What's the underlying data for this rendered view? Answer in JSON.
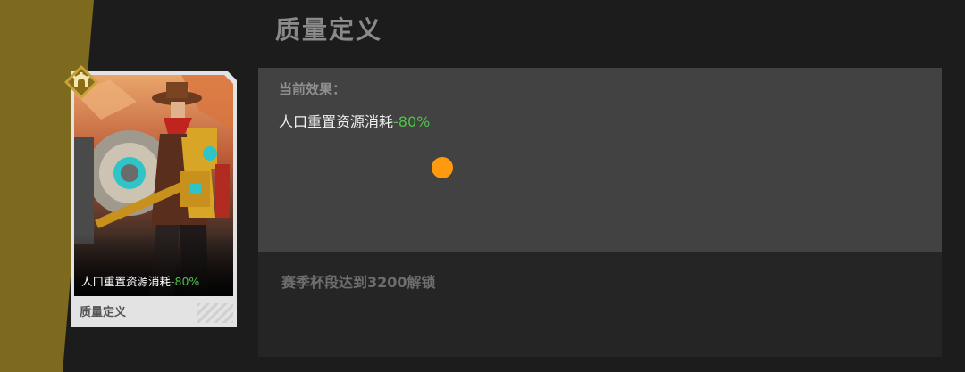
{
  "page": {
    "title": "质量定义"
  },
  "card": {
    "effect_text": "人口重置资源消耗",
    "effect_value": "-80%",
    "label": "质量定义",
    "badge_icon": "gear-arch-icon"
  },
  "effect_panel": {
    "heading": "当前效果：",
    "effect_text": "人口重置资源消耗",
    "effect_value": "-80%"
  },
  "unlock_panel": {
    "text": "赛季杯段达到3200解锁"
  },
  "colors": {
    "accent_green": "#4fc24a",
    "olive": "#7d6a1e",
    "cursor": "#ff9a0e"
  }
}
